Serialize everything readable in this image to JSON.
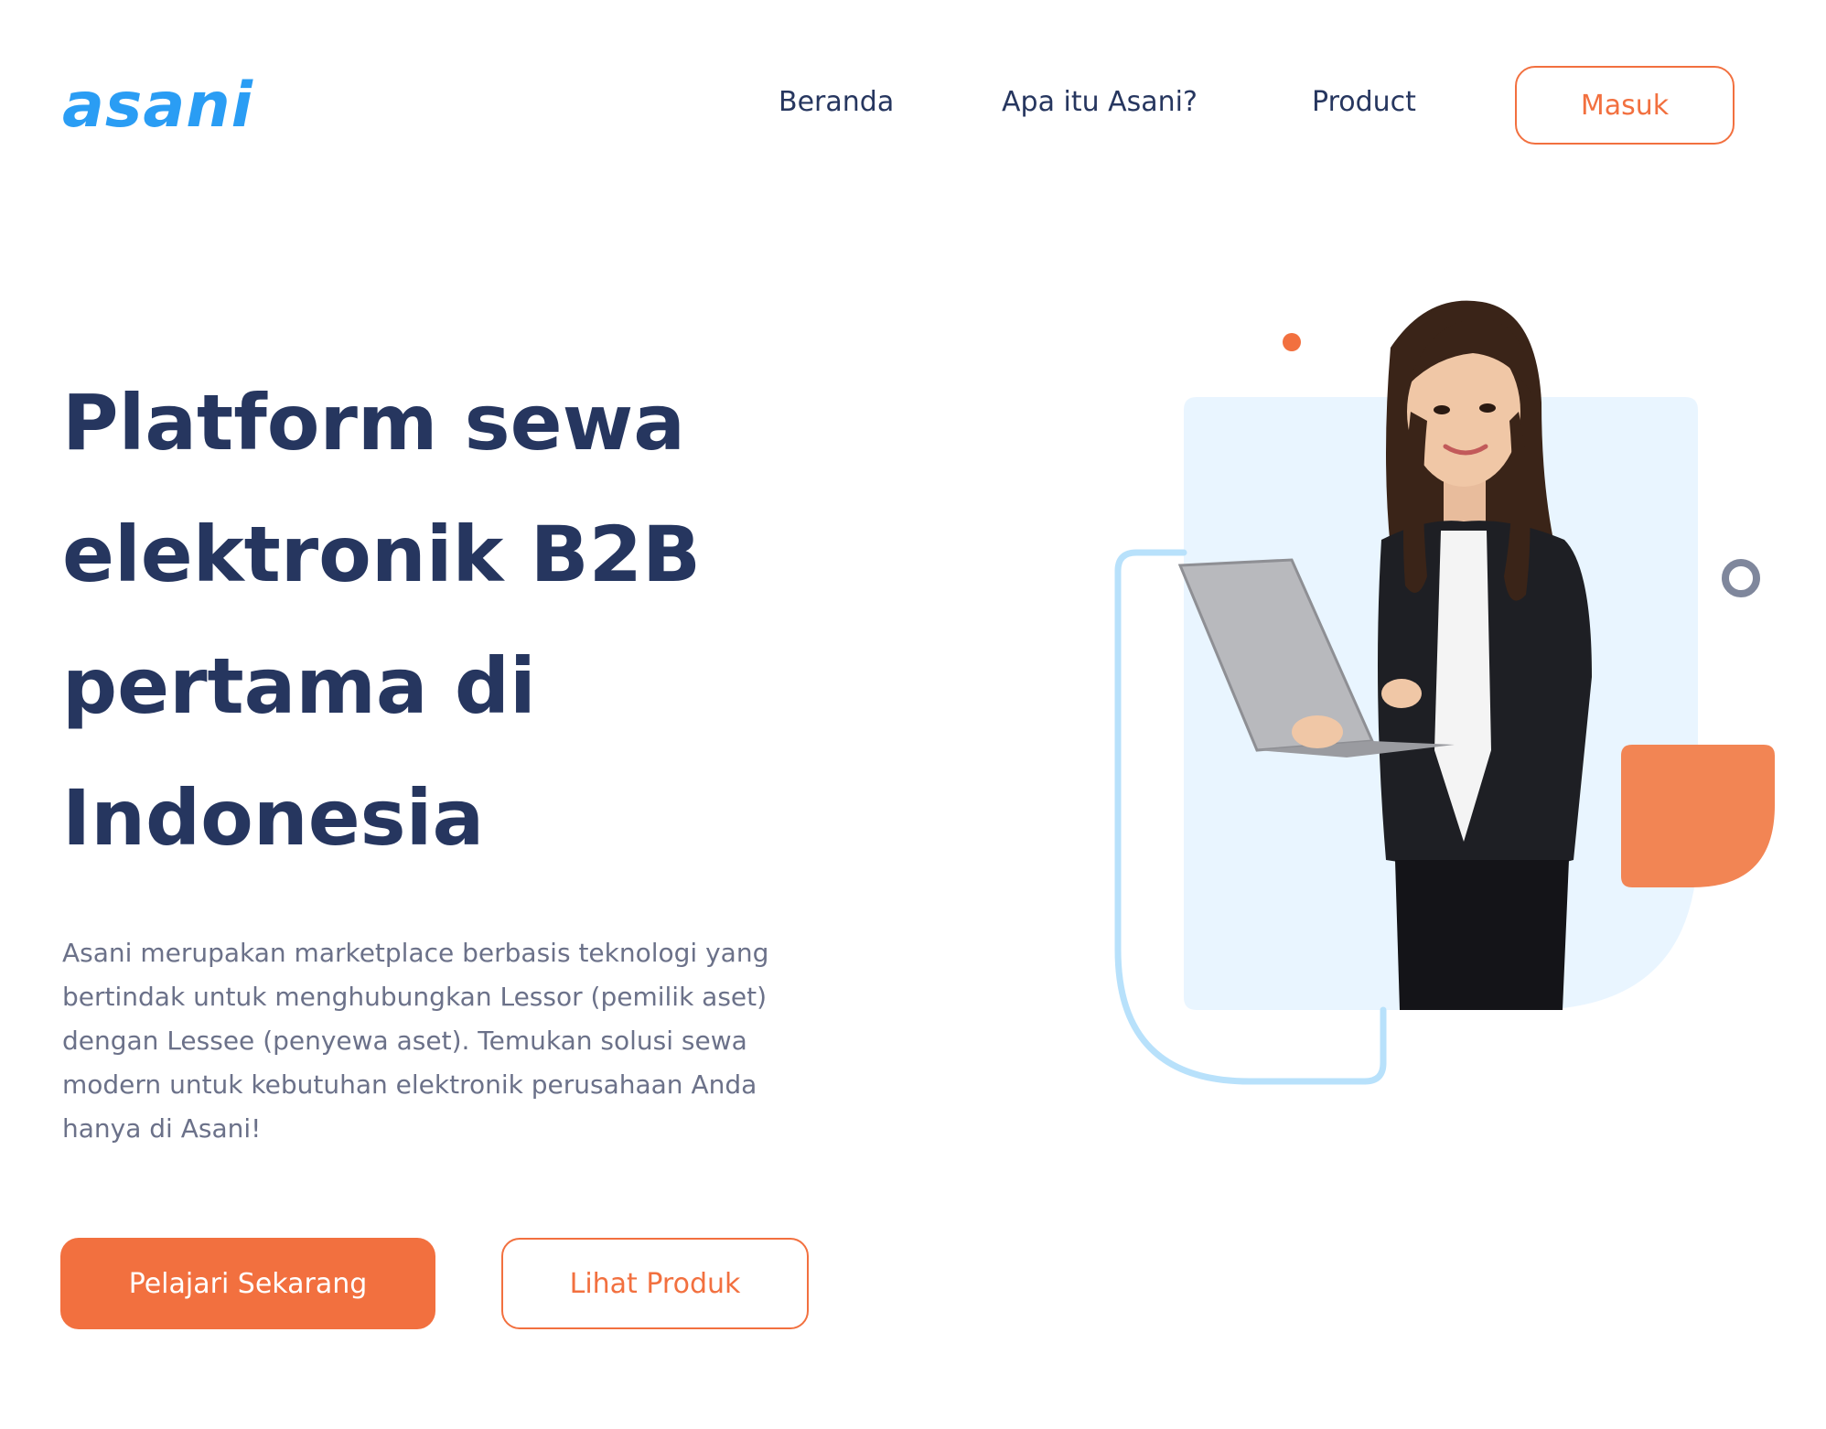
{
  "header": {
    "logo_text": "asani",
    "nav": [
      {
        "label": "Beranda"
      },
      {
        "label": "Apa itu Asani?"
      },
      {
        "label": "Product"
      }
    ],
    "login_label": "Masuk"
  },
  "hero": {
    "title_lines": [
      "Platform sewa",
      "elektronik B2B",
      "pertama di",
      "Indonesia"
    ],
    "description_lines": [
      "Asani merupakan marketplace berbasis teknologi yang",
      "bertindak untuk menghubungkan Lessor (pemilik aset)",
      "dengan Lessee (penyewa aset). Temukan solusi sewa",
      "modern untuk kebutuhan elektronik perusahaan Anda",
      "hanya di Asani!"
    ],
    "primary_button": "Pelajari Sekarang",
    "secondary_button": "Lihat Produk"
  },
  "illustration": {
    "subject": "woman-with-laptop",
    "colors": {
      "accent": "#f2703f",
      "panel": "#e9f5ff",
      "outline": "#b8e1fb",
      "ring": "#7f879c",
      "heading": "#26365f",
      "logo": "#2a9df4"
    }
  }
}
